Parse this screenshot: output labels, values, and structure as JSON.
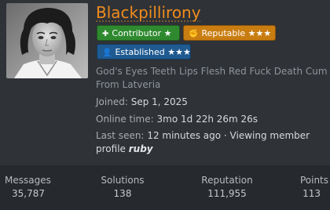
{
  "profile": {
    "username": "Blackpillirony",
    "badges": [
      {
        "label": "Contributor ★",
        "icon": "✚"
      },
      {
        "label": "Reputable ★★★",
        "icon": "✊"
      },
      {
        "label": "Established ★★★",
        "icon": "👤"
      }
    ],
    "blurb_line1": "God's Eyes Teeth Lips Flesh Red Fuck Death Cum ·",
    "blurb_line2": "From Latveria",
    "joined_label": "Joined:",
    "joined_value": "Sep 1, 2025",
    "online_label": "Online time:",
    "online_value": "3mo 1d 22h 26m 26s",
    "lastseen_label": "Last seen:",
    "lastseen_value": "12 minutes ago · Viewing member",
    "lastseen_value2": "profile",
    "lastseen_name": "ruby"
  },
  "stats": [
    {
      "label": "Messages",
      "value": "35,787"
    },
    {
      "label": "Solutions",
      "value": "138"
    },
    {
      "label": "Reputation",
      "value": "111,955"
    },
    {
      "label": "Points",
      "value": "113"
    }
  ],
  "colors": {
    "username": "#f08c1e",
    "contributor": "#2f8a2f",
    "reputable": "#c97d11",
    "established": "#1f5a91",
    "background": "#2f3236",
    "stats_bar": "#26292d"
  }
}
